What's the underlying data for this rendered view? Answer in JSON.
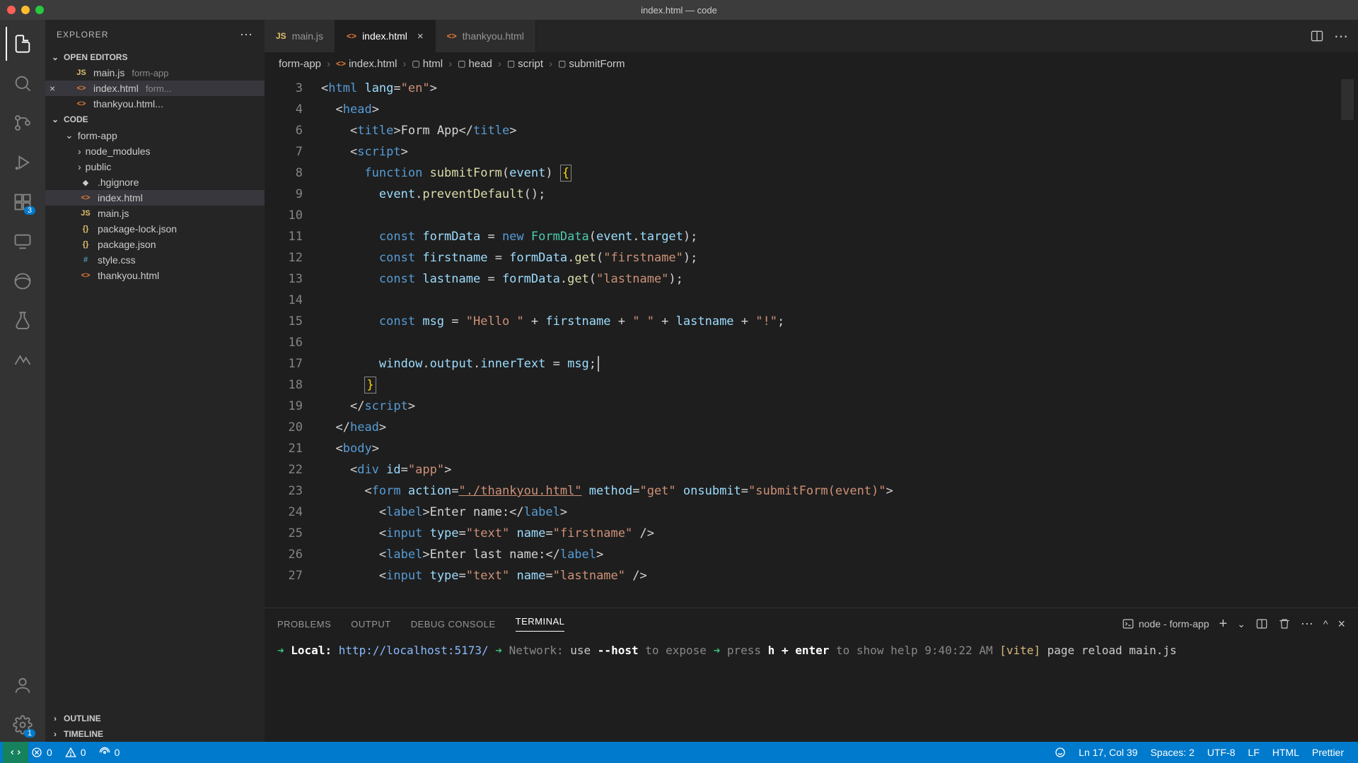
{
  "window": {
    "title": "index.html — code"
  },
  "activity": {
    "ext_badge": "3",
    "acct_badge": "1"
  },
  "sidebar": {
    "title": "EXPLORER",
    "open_editors_label": "OPEN EDITORS",
    "open_editors": [
      {
        "icon": "JS",
        "name": "main.js",
        "detail": "form-app"
      },
      {
        "icon": "<>",
        "name": "index.html",
        "detail": "form..."
      },
      {
        "icon": "<>",
        "name": "thankyou.html...",
        "detail": ""
      }
    ],
    "workspace_label": "CODE",
    "folder": "form-app",
    "files": [
      {
        "kind": "folder",
        "icon": "›",
        "name": "node_modules"
      },
      {
        "kind": "folder",
        "icon": "›",
        "name": "public"
      },
      {
        "kind": "file",
        "icon": "◆",
        "name": ".hgignore"
      },
      {
        "kind": "file",
        "icon": "<>",
        "name": "index.html",
        "selected": true
      },
      {
        "kind": "file",
        "icon": "JS",
        "name": "main.js"
      },
      {
        "kind": "file",
        "icon": "{}",
        "name": "package-lock.json"
      },
      {
        "kind": "file",
        "icon": "{}",
        "name": "package.json"
      },
      {
        "kind": "file",
        "icon": "#",
        "name": "style.css"
      },
      {
        "kind": "file",
        "icon": "<>",
        "name": "thankyou.html"
      }
    ],
    "outline_label": "OUTLINE",
    "timeline_label": "TIMELINE"
  },
  "tabs": [
    {
      "icon": "JS",
      "label": "main.js",
      "active": false
    },
    {
      "icon": "<>",
      "label": "index.html",
      "active": true,
      "closeable": true
    },
    {
      "icon": "<>",
      "label": "thankyou.html",
      "active": false
    }
  ],
  "breadcrumbs": [
    {
      "label": "form-app"
    },
    {
      "icon": "<>",
      "label": "index.html"
    },
    {
      "icon": "⃞",
      "label": "html"
    },
    {
      "icon": "⃞",
      "label": "head"
    },
    {
      "icon": "⃞",
      "label": "script"
    },
    {
      "icon": "⃞",
      "label": "submitForm"
    }
  ],
  "editor": {
    "line_numbers": [
      "3",
      "4",
      "6",
      "7",
      "8",
      "9",
      "10",
      "11",
      "12",
      "13",
      "14",
      "15",
      "16",
      "17",
      "18",
      "19",
      "20",
      "21",
      "22",
      "23",
      "24",
      "25",
      "26",
      "27"
    ],
    "ln": "Ln 17, Col 39"
  },
  "panel": {
    "tabs": [
      "PROBLEMS",
      "OUTPUT",
      "DEBUG CONSOLE",
      "TERMINAL"
    ],
    "active_idx": 3,
    "task_label": "node - form-app",
    "terminal": {
      "local_label": "Local:",
      "local_url": "http://localhost:5173/",
      "network": "Network: use --host to expose",
      "help": "press h + enter to show help",
      "reload": "9:40:22 AM [vite] page reload main.js"
    }
  },
  "status": {
    "errors": "0",
    "warnings": "0",
    "ports": "0",
    "spaces": "Spaces: 2",
    "encoding": "UTF-8",
    "eol": "LF",
    "lang": "HTML",
    "prettier": "Prettier"
  }
}
